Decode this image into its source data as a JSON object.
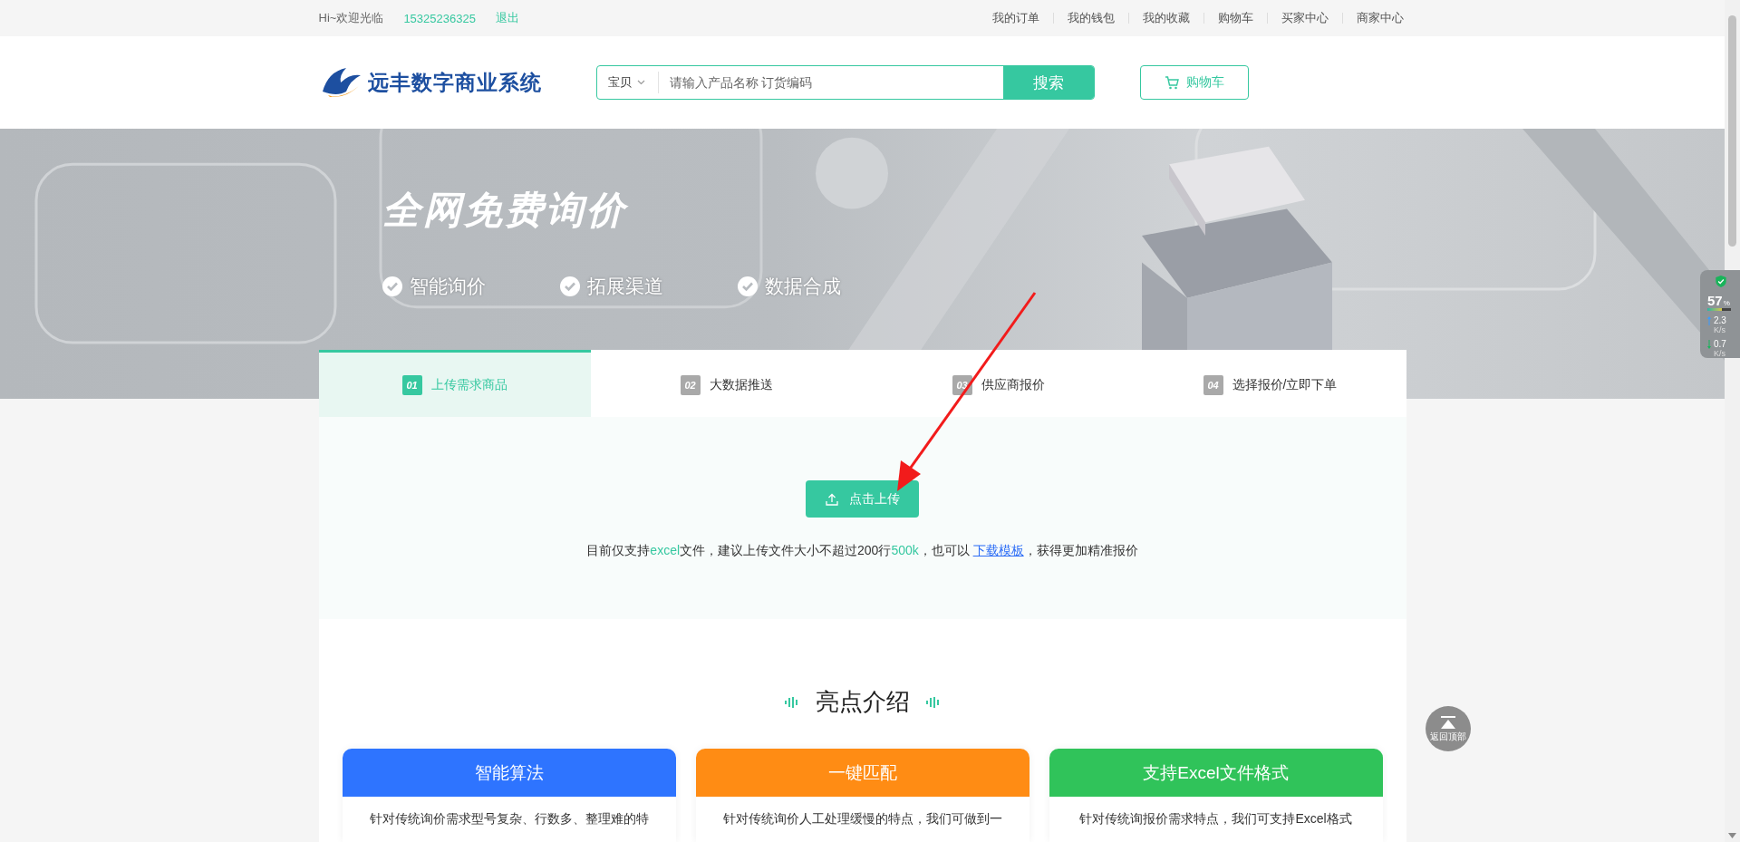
{
  "top_bar": {
    "greeting": "Hi~欢迎光临",
    "phone": "15325236325",
    "logout": "退出",
    "links": [
      "我的订单",
      "我的钱包",
      "我的收藏",
      "购物车",
      "买家中心",
      "商家中心"
    ]
  },
  "header": {
    "logo_text": "远丰数字商业系统",
    "search": {
      "scope": "宝贝",
      "placeholder": "请输入产品名称 订货编码",
      "button": "搜索"
    },
    "cart_button": "购物车"
  },
  "banner": {
    "title": "全网免费询价",
    "features": [
      "智能询价",
      "拓展渠道",
      "数据合成"
    ]
  },
  "steps": [
    {
      "number": "01",
      "label": "上传需求商品",
      "selected": true
    },
    {
      "number": "02",
      "label": "大数据推送",
      "selected": false
    },
    {
      "number": "03",
      "label": "供应商报价",
      "selected": false
    },
    {
      "number": "04",
      "label": "选择报价/立即下单",
      "selected": false
    }
  ],
  "upload": {
    "button": "点击上传",
    "note": [
      {
        "kind": "plain",
        "text": "目前仅支持"
      },
      {
        "kind": "highlight",
        "text": "excel"
      },
      {
        "kind": "plain",
        "text": "文件，建议上传文件大小不超过200行"
      },
      {
        "kind": "highlight",
        "text": "500k"
      },
      {
        "kind": "plain",
        "text": "，也可以 "
      },
      {
        "kind": "link",
        "text": "下载模板"
      },
      {
        "kind": "plain",
        "text": "，获得更加精准报价"
      }
    ]
  },
  "highlights": {
    "title": "亮点介绍",
    "cards": [
      {
        "title": "智能算法",
        "color": "#2e74ff",
        "text": "针对传统询价需求型号复杂、行数多、整理难的特"
      },
      {
        "title": "一键匹配",
        "color": "#ff8c14",
        "text": "针对传统询价人工处理缓慢的特点，我们可做到一"
      },
      {
        "title": "支持Excel文件格式",
        "color": "#30c35a",
        "text": "针对传统询报价需求特点，我们可支持Excel格式"
      }
    ]
  },
  "float_widget": {
    "percent": "57",
    "percent_unit": "%",
    "up": "2.3",
    "up_unit": "K/s",
    "down": "0.7",
    "down_unit": "K/s"
  },
  "back_to_top": "返回顶部"
}
